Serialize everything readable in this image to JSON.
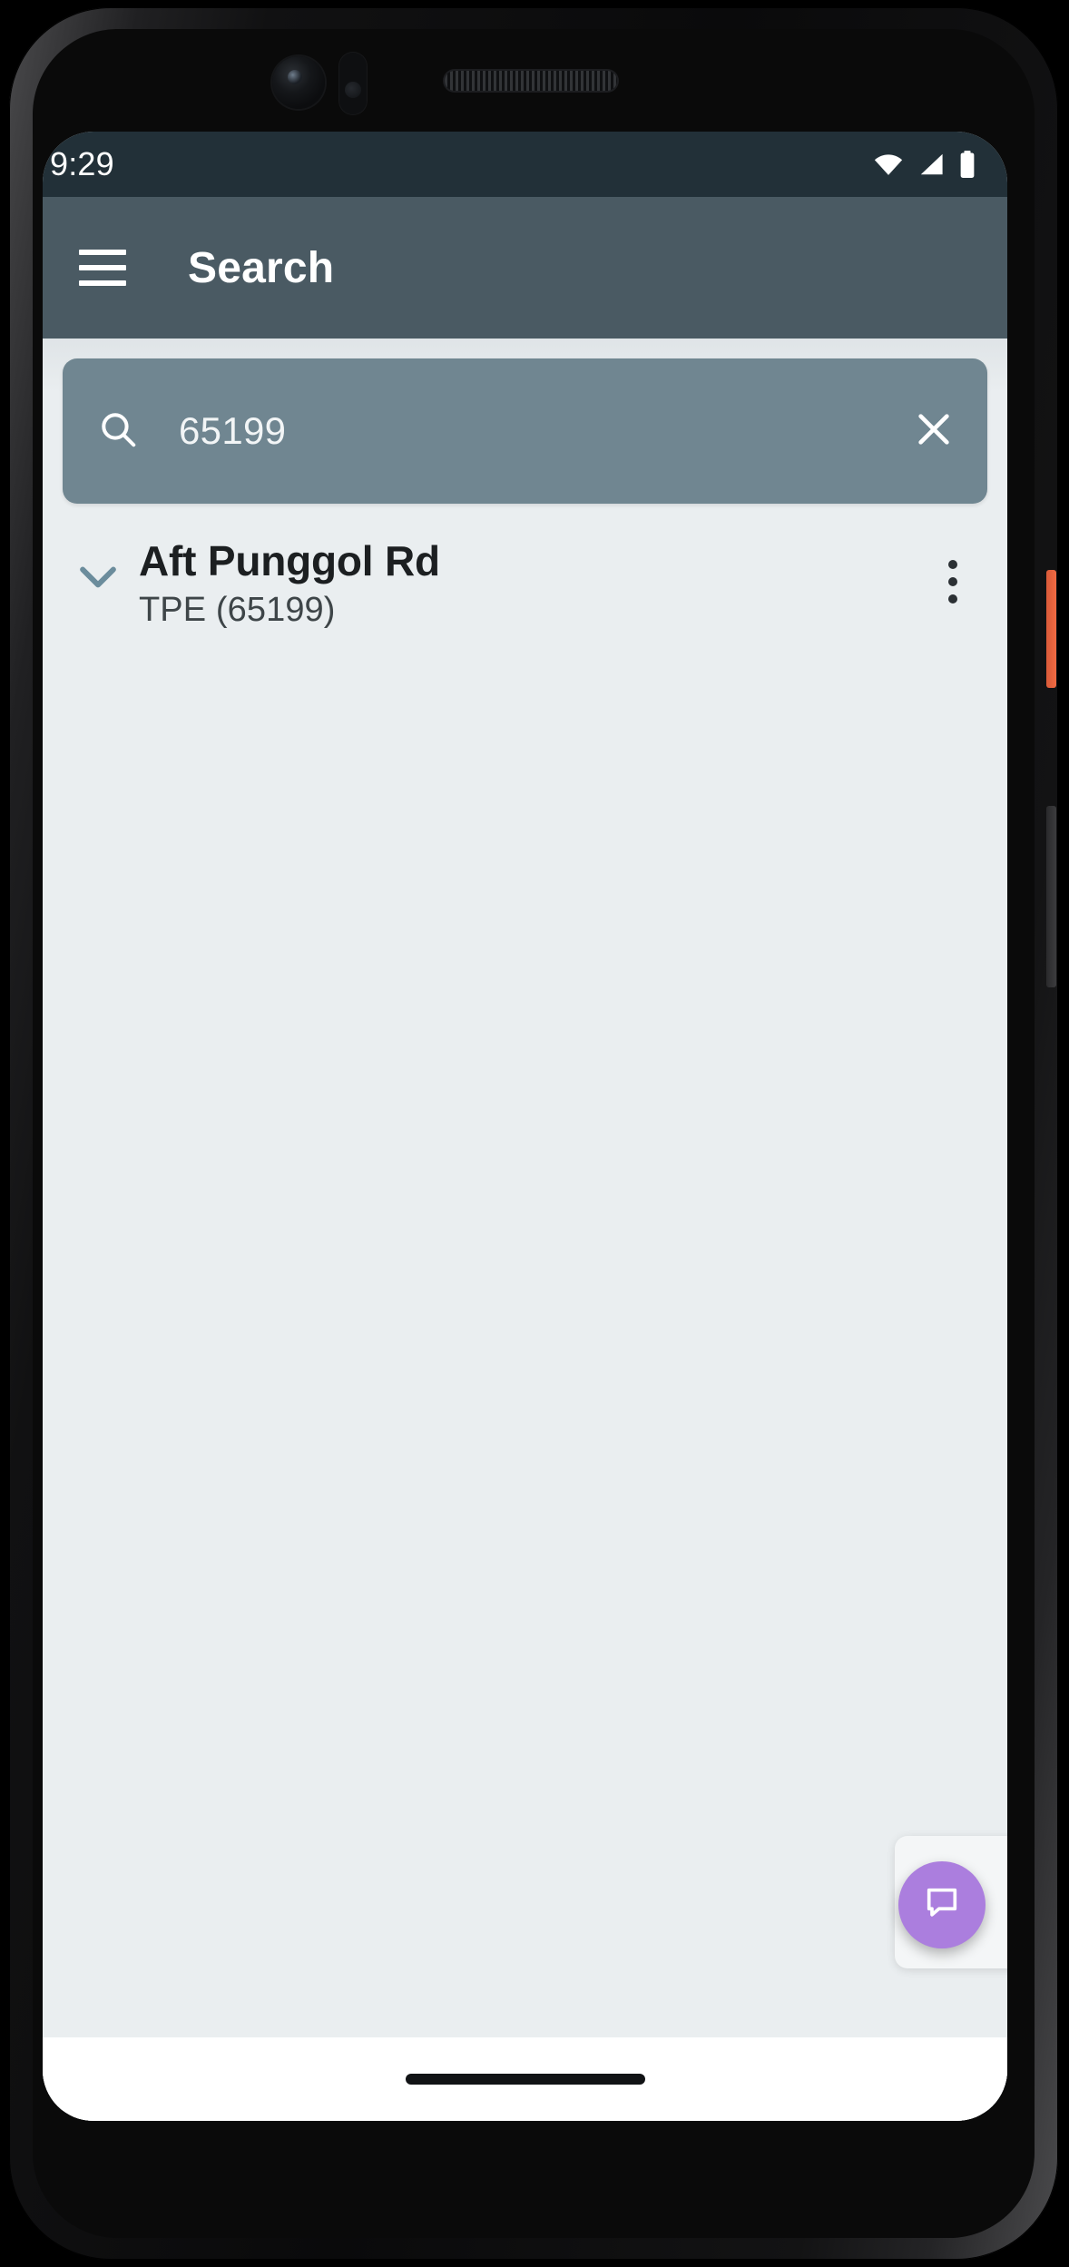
{
  "device": {
    "frame_color": "#111112",
    "power_button_color": "#e0603d"
  },
  "statusbar": {
    "time": "9:29",
    "icons": [
      "wifi-icon",
      "cellular-signal-icon",
      "battery-icon"
    ],
    "background": "#223038",
    "foreground": "#ffffff"
  },
  "appbar": {
    "menu_icon": "hamburger-menu-icon",
    "title": "Search",
    "background": "#4a5a63",
    "foreground": "#ffffff"
  },
  "search": {
    "icon": "search-icon",
    "value": "65199",
    "placeholder": "Search",
    "clear_icon": "close-icon",
    "background": "#708691",
    "text_color": "#f2f5f6"
  },
  "results": {
    "count": 1,
    "items": [
      {
        "expand_icon": "chevron-down-icon",
        "title": "Aft Punggol Rd",
        "subtitle": "TPE (65199)",
        "overflow_icon": "more-vertical-icon"
      }
    ]
  },
  "fab": {
    "icon": "chat-bubble-icon",
    "color": "#ab7ede"
  },
  "navbar": {
    "gesture_pill": "home-gesture-pill",
    "background": "#ffffff"
  },
  "theme": {
    "page_background": "#eaeef0",
    "accent": "#6b8c9c",
    "title_text": "#1c1f21",
    "subtitle_text": "#3e4548"
  }
}
